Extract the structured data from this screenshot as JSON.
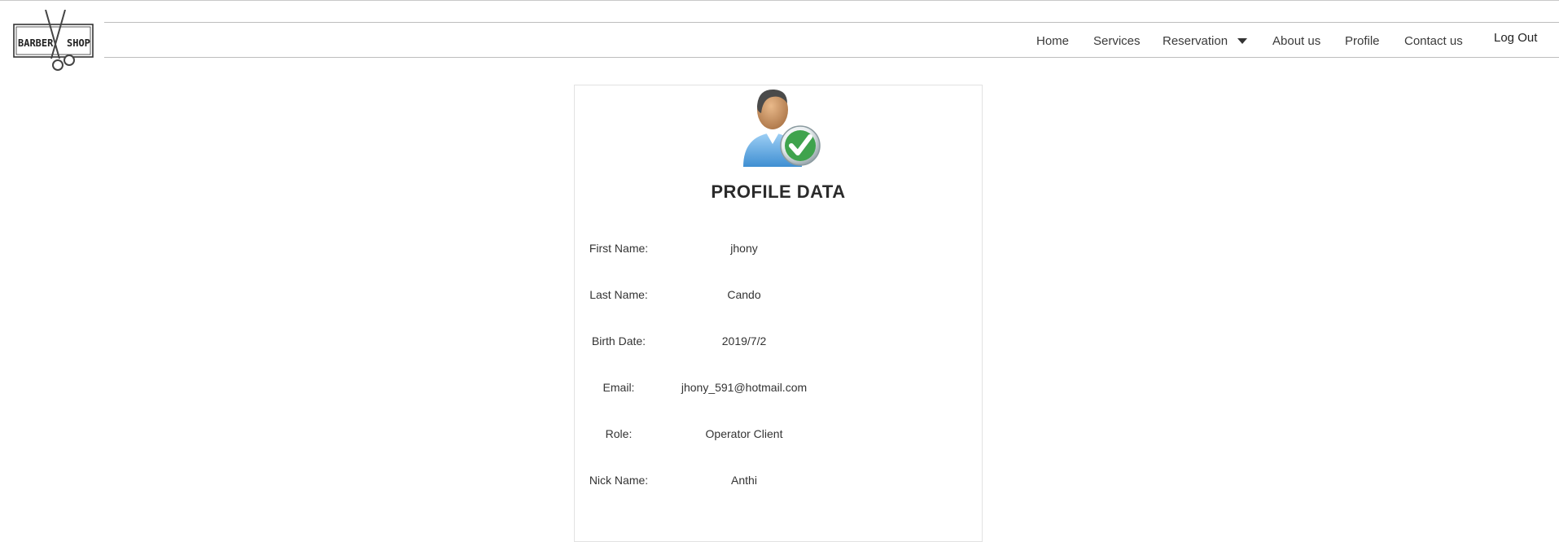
{
  "logo": {
    "left_text": "BARBER",
    "right_text": "SHOP"
  },
  "nav": {
    "items": [
      "Home",
      "Services",
      "Reservation",
      "About us",
      "Profile",
      "Contact us"
    ],
    "logout": "Log Out"
  },
  "profile": {
    "title": "PROFILE DATA",
    "fields": [
      {
        "label": "First Name:",
        "value": "jhony"
      },
      {
        "label": "Last Name:",
        "value": "Cando"
      },
      {
        "label": "Birth Date:",
        "value": "2019/7/2"
      },
      {
        "label": "Email:",
        "value": "jhony_591@hotmail.com"
      },
      {
        "label": "Role:",
        "value": "Operator Client"
      },
      {
        "label": "Nick Name:",
        "value": "Anthi"
      }
    ]
  }
}
